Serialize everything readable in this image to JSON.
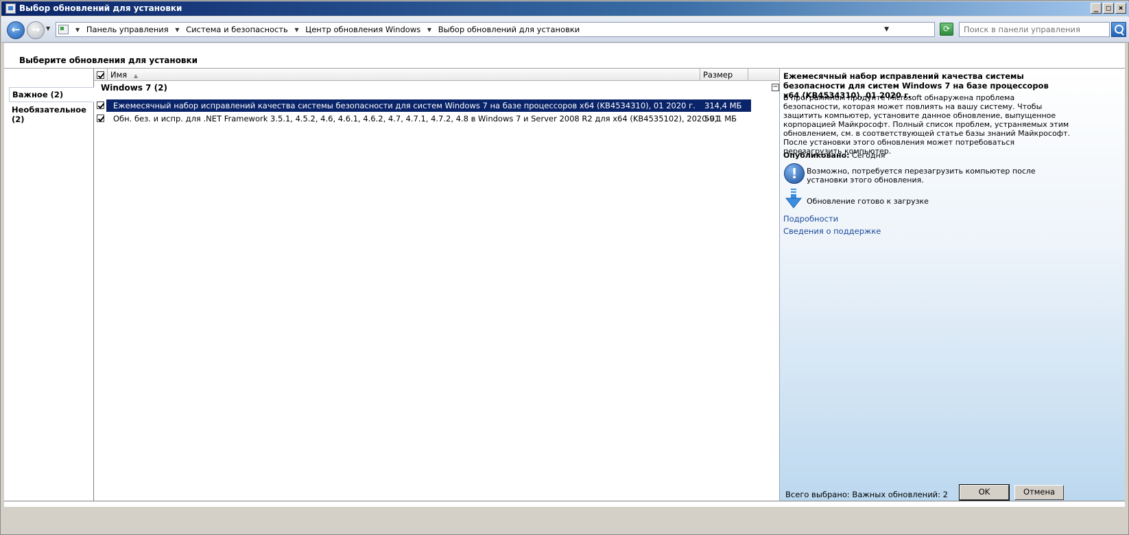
{
  "window": {
    "title": "Выбор обновлений для установки",
    "controls": {
      "minimize": "_",
      "maximize": "□",
      "close": "×"
    }
  },
  "address_bar": {
    "back_glyph": "←",
    "forward_glyph": "→",
    "breadcrumbs": [
      "Панель управления",
      "Система и безопасность",
      "Центр обновления Windows",
      "Выбор обновлений для установки"
    ],
    "refresh_glyph": "⟳",
    "search_placeholder": "Поиск в панели управления"
  },
  "page": {
    "title": "Выберите обновления для установки"
  },
  "categories": [
    {
      "label": "Важное (2)",
      "selected": true
    },
    {
      "label": "Необязательное (2)",
      "selected": false
    }
  ],
  "columns": {
    "name": "Имя",
    "size": "Размер",
    "sort_glyph": "▲"
  },
  "group": {
    "title": "Windows 7 (2)",
    "collapse_glyph": "−"
  },
  "updates": [
    {
      "name": "Ежемесячный набор исправлений качества системы безопасности для систем Windows 7 на базе процессоров x64 (KB4534310), 01 2020 г.",
      "size": "314,4 МБ",
      "checked": true,
      "selected": true
    },
    {
      "name": "Обн. без. и испр. для .NET Framework 3.5.1, 4.5.2, 4.6, 4.6.1, 4.6.2, 4.7, 4.7.1, 4.7.2, 4.8 в Windows 7 и Server 2008 R2 для x64 (KB4535102), 2020-01",
      "size": "59,1 МБ",
      "checked": true,
      "selected": false
    }
  ],
  "details": {
    "title": "Ежемесячный набор исправлений качества системы безопасности для систем Windows 7 на базе процессоров x64 (KB4534310), 01 2020 г.",
    "description": "В программном продукте Microsoft обнаружена проблема безопасности, которая может повлиять на вашу систему. Чтобы защитить компьютер, установите данное обновление, выпущенное корпорацией Майкрософт. Полный список проблем, устраняемых этим обновлением, см. в соответствующей статье базы знаний Майкрософт. После установки этого обновления может потребоваться перезагрузить компьютер.",
    "published_label": "Опубликовано:",
    "published_value": "Сегодня",
    "restart_note": "Возможно, потребуется перезагрузить компьютер после установки этого обновления.",
    "restart_icon": "info-icon",
    "restart_glyph": "!",
    "download_status": "Обновление готово к загрузке",
    "download_icon": "download-arrow-icon",
    "link_details": "Подробности",
    "link_support": "Сведения о поддержке"
  },
  "footer": {
    "status": "Всего выбрано: Важных обновлений: 2",
    "ok_label": "OK",
    "cancel_label": "Отмена"
  }
}
